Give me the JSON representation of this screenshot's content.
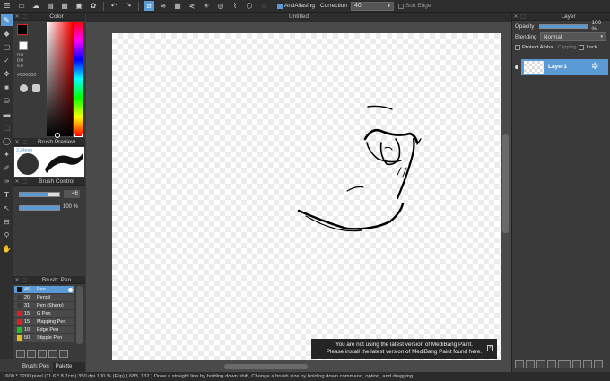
{
  "toolbar": {
    "antialiasing_label": "AntiAliasing",
    "correction_label": "Correction",
    "correction_value": "40",
    "soft_edge_label": "Soft Edge"
  },
  "document": {
    "title": "Untitled"
  },
  "color_panel": {
    "title": "Color",
    "rgb_lines": [
      "0:0",
      "0:0",
      "0:0"
    ],
    "hex_value": "#000000",
    "fg_color": "#000000",
    "bg_color": "#ffffff",
    "accent": "#5b9bd5"
  },
  "brush_preview": {
    "title": "Brush Preview",
    "size_label": "3.24mm"
  },
  "brush_control": {
    "title": "Brush Control",
    "size_value": "46",
    "opacity_value": "100 %"
  },
  "brush_list": {
    "title": "Brush: Pen",
    "items": [
      {
        "size": "46",
        "name": "Pen",
        "color": "#111111"
      },
      {
        "size": "20",
        "name": "Pencil",
        "color": "#3a3a3a"
      },
      {
        "size": "31",
        "name": "Pen (Sharp)",
        "color": "#3a3a3a"
      },
      {
        "size": "15",
        "name": "G Pen",
        "color": "#e02020"
      },
      {
        "size": "15",
        "name": "Mapping Pen",
        "color": "#e02020"
      },
      {
        "size": "10",
        "name": "Edge Pen",
        "color": "#20c020"
      },
      {
        "size": "50",
        "name": "Stipple Pen",
        "color": "#e0c020"
      }
    ],
    "tab_brush": "Brush: Pen",
    "tab_palette": "Palette"
  },
  "layer_panel": {
    "title": "Layer",
    "opacity_label": "Opacity",
    "opacity_value": "100 %",
    "blending_label": "Blending",
    "blending_value": "Normal",
    "protect_alpha": "Protect Alpha",
    "clipping": "Clipping",
    "lock": "Lock",
    "layer_name": "Layer1"
  },
  "toast": {
    "line1": "You are not using the latest version of MediBang Paint.",
    "line2": "Please install the latest version of MediBang Paint found here.",
    "close": "×"
  },
  "status": {
    "text": "1600 * 1200 pixel   (11.6 * 8.7cm)   350 dpi   100 % (Flip)   ( 683, 132 )   Draw a straight line by holding down shift, Change a brush size by holding down command, option, and dragging"
  }
}
